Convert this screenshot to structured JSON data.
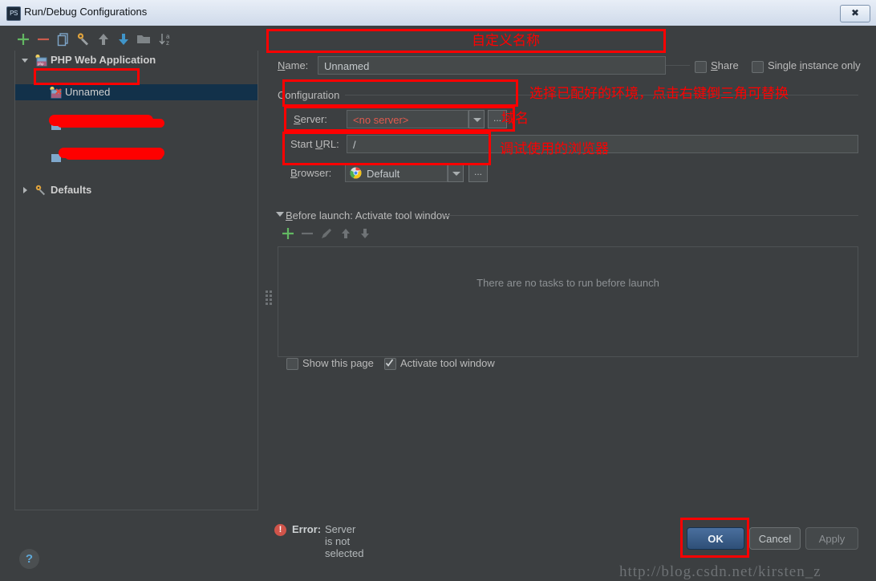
{
  "window": {
    "title": "Run/Debug Configurations",
    "app_icon": "phpstorm-icon",
    "close_label": "✖"
  },
  "left_toolbar": {
    "items": [
      {
        "name": "add-icon",
        "tip": "Add"
      },
      {
        "name": "remove-icon",
        "tip": "Remove"
      },
      {
        "name": "copy-icon",
        "tip": "Copy Configuration"
      },
      {
        "name": "edit-templates-icon",
        "tip": "Edit Templates"
      },
      {
        "name": "move-up-icon",
        "tip": "Move Up"
      },
      {
        "name": "move-down-icon",
        "tip": "Move Down"
      },
      {
        "name": "folder-icon",
        "tip": "Create New Folder"
      },
      {
        "name": "sort-alphabetically-icon",
        "tip": "Sort Configurations"
      }
    ]
  },
  "tree": {
    "nodes": [
      {
        "label": "PHP Web Application",
        "icon": "php-web-app-icon",
        "expanded": true,
        "bold": true,
        "selected": false,
        "indent": 0,
        "redacted": false
      },
      {
        "label": "Unnamed",
        "icon": "php-web-app-error-icon",
        "expanded": null,
        "bold": false,
        "selected": true,
        "indent": 1,
        "redacted": false
      },
      {
        "label": "",
        "icon": "php-web-app-icon",
        "expanded": null,
        "bold": false,
        "selected": false,
        "indent": 1,
        "redacted": true
      },
      {
        "label": "",
        "icon": "php-web-app-icon",
        "expanded": null,
        "bold": false,
        "selected": false,
        "indent": 1,
        "redacted": true
      },
      {
        "label": "Defaults",
        "icon": "defaults-icon",
        "expanded": false,
        "bold": true,
        "selected": false,
        "indent": 0,
        "redacted": false
      }
    ]
  },
  "name_row": {
    "label": "Name:",
    "mnemonic": "N",
    "value": "Unnamed",
    "share": {
      "label": "Share",
      "checked": false
    },
    "single_instance": {
      "label": "Single instance only",
      "checked": false
    }
  },
  "configuration": {
    "group_title": "Configuration",
    "server": {
      "label": "Server:",
      "mnemonic": "S",
      "value": "<no server>",
      "value_color": "#e05a4e",
      "browse_label": "..."
    },
    "start_url": {
      "label": "Start URL:",
      "mnemonic": "U",
      "value": "/"
    },
    "browser": {
      "label": "Browser:",
      "mnemonic": "B",
      "value": "Default",
      "icon": "chrome-icon",
      "browse_label": "..."
    }
  },
  "before_launch": {
    "title": "Before launch: Activate tool window",
    "expanded": true,
    "toolbar": [
      {
        "name": "add-task-icon",
        "enabled": true
      },
      {
        "name": "remove-task-icon",
        "enabled": false
      },
      {
        "name": "edit-task-icon",
        "enabled": false
      },
      {
        "name": "move-task-up-icon",
        "enabled": false
      },
      {
        "name": "move-task-down-icon",
        "enabled": false
      }
    ],
    "empty_text": "There are no tasks to run before launch",
    "show_this_page": {
      "label": "Show this page",
      "checked": false
    },
    "activate_tool_window": {
      "label": "Activate tool window",
      "checked": true
    }
  },
  "status": {
    "error_prefix": "Error:",
    "error_message": "Server is not selected",
    "icon": "error-icon"
  },
  "footer": {
    "help_label": "?",
    "ok_label": "OK",
    "cancel_label": "Cancel",
    "apply_label": "Apply",
    "apply_enabled": false,
    "watermark": "http://blog.csdn.net/kirsten_z"
  },
  "annotations": {
    "color": "#fe0000",
    "notes": [
      {
        "text": "自定义名称",
        "target": "name-field"
      },
      {
        "text": "选择已配好的环境，点击右键倒三角可替换",
        "target": "server-row"
      },
      {
        "text": "域名",
        "target": "start-url-row"
      },
      {
        "text": "调试使用的浏览器",
        "target": "browser-row"
      }
    ]
  }
}
